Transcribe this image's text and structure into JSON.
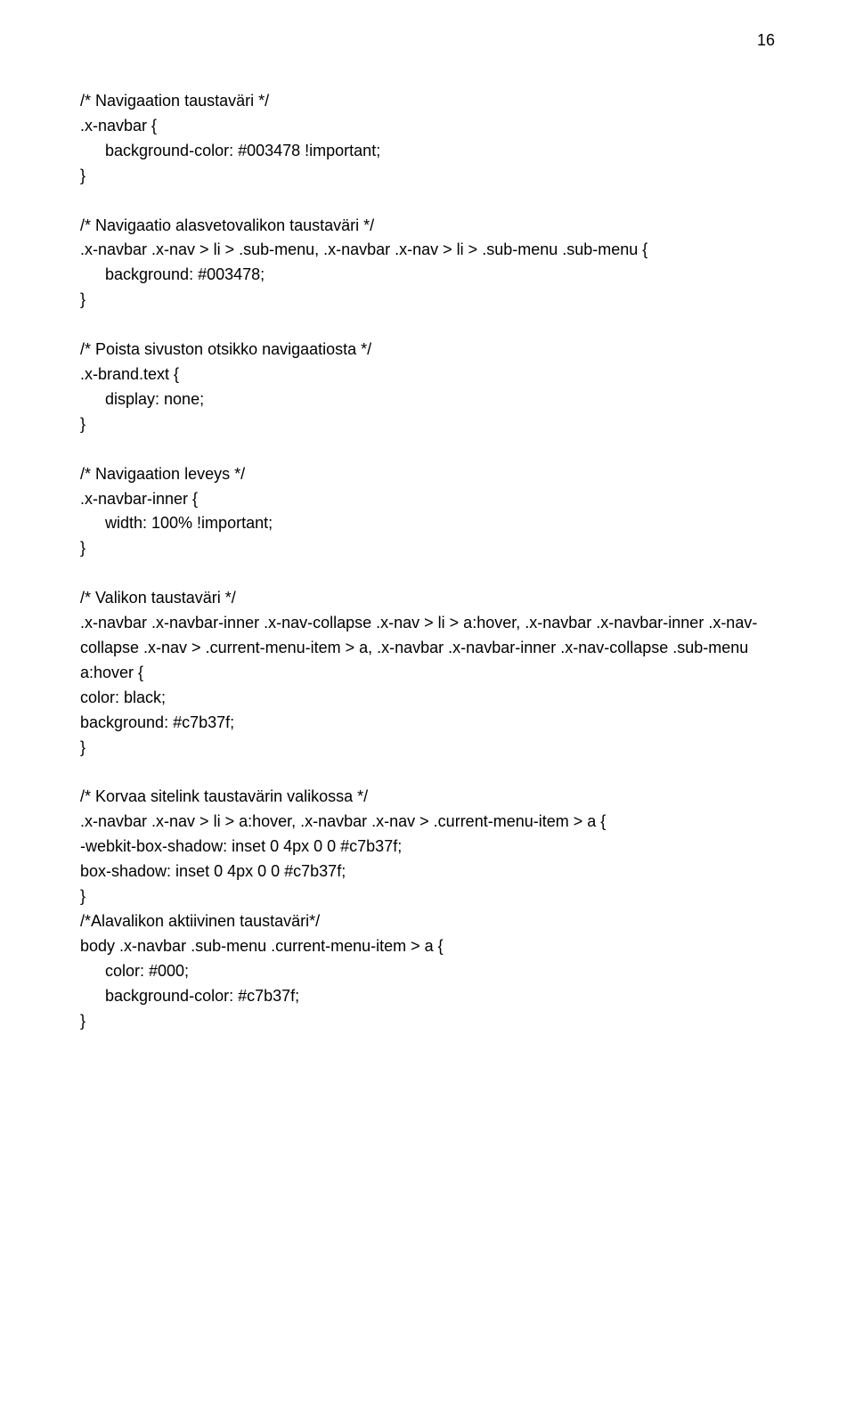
{
  "pageNumber": "16",
  "blocks": [
    {
      "lines": [
        "/* Navigaation taustaväri */",
        ".x-navbar {",
        {
          "text": "background-color: #003478 !important;",
          "indent": true
        },
        "}"
      ]
    },
    {
      "lines": [
        "/* Navigaatio alasvetovalikon taustaväri */",
        ".x-navbar .x-nav > li > .sub-menu, .x-navbar .x-nav > li > .sub-menu .sub-menu {",
        {
          "text": "background: #003478;",
          "indent": true
        },
        "}"
      ]
    },
    {
      "lines": [
        "/* Poista sivuston otsikko navigaatiosta */",
        ".x-brand.text {",
        {
          "text": "display: none;",
          "indent": true
        },
        "}"
      ]
    },
    {
      "lines": [
        "/* Navigaation leveys */",
        ".x-navbar-inner {",
        {
          "text": "width: 100% !important;",
          "indent": true
        },
        "}"
      ]
    },
    {
      "lines": [
        "/* Valikon taustaväri */",
        ".x-navbar .x-navbar-inner .x-nav-collapse .x-nav > li > a:hover, .x-navbar .x-navbar-inner .x-nav-collapse .x-nav > .current-menu-item > a, .x-navbar .x-navbar-inner .x-nav-collapse .sub-menu a:hover {",
        "color: black;",
        "background: #c7b37f;",
        "}"
      ]
    },
    {
      "lines": [
        "/* Korvaa sitelink taustavärin valikossa */",
        ".x-navbar .x-nav > li > a:hover, .x-navbar .x-nav > .current-menu-item > a {",
        "-webkit-box-shadow: inset 0 4px 0 0 #c7b37f;",
        "box-shadow: inset 0 4px 0 0 #c7b37f;",
        "}",
        "/*Alavalikon aktiivinen taustaväri*/",
        "body .x-navbar .sub-menu .current-menu-item > a {",
        {
          "text": "color: #000;",
          "indent": true
        },
        {
          "text": "background-color: #c7b37f;",
          "indent": true
        },
        "}"
      ]
    }
  ]
}
